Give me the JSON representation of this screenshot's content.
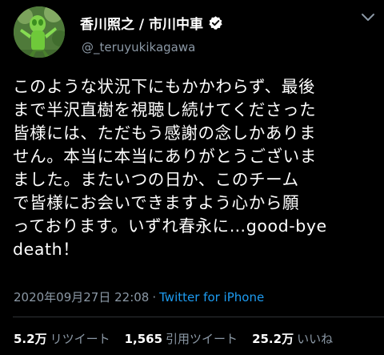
{
  "tweet": {
    "display_name": "香川照之 / 市川中車",
    "handle": "@_teruyukikagawa",
    "verified": true,
    "body_lines": [
      "このような状況下にもかかわらず、最後",
      "まで半沢直樹を視聴し続けてくださった",
      "皆様には、ただもう感謝の念しかありま",
      "せん。本当に本当にありがとうございま",
      "ました。またいつの日か、このチーム",
      "で皆様にお会いできますよう心から願",
      "っております。いずれ春永に…good-bye",
      "death！"
    ],
    "timestamp": "2020年09月27日 22:08",
    "separator": "·",
    "source": "Twitter for iPhone",
    "stats": {
      "retweets_count": "5.2万",
      "retweets_label": "リツイート",
      "quotes_count": "1,565",
      "quotes_label": "引用ツイート",
      "likes_count": "25.2万",
      "likes_label": "いいね"
    }
  },
  "colors": {
    "background": "#000000",
    "primary_text": "#ffffff",
    "secondary_text": "#8b98a5",
    "link": "#1d9bf0",
    "divider": "#2f3336"
  },
  "icons": {
    "verified": "verified-badge-icon",
    "more": "chevron-down-icon",
    "avatar": "profile-photo"
  }
}
